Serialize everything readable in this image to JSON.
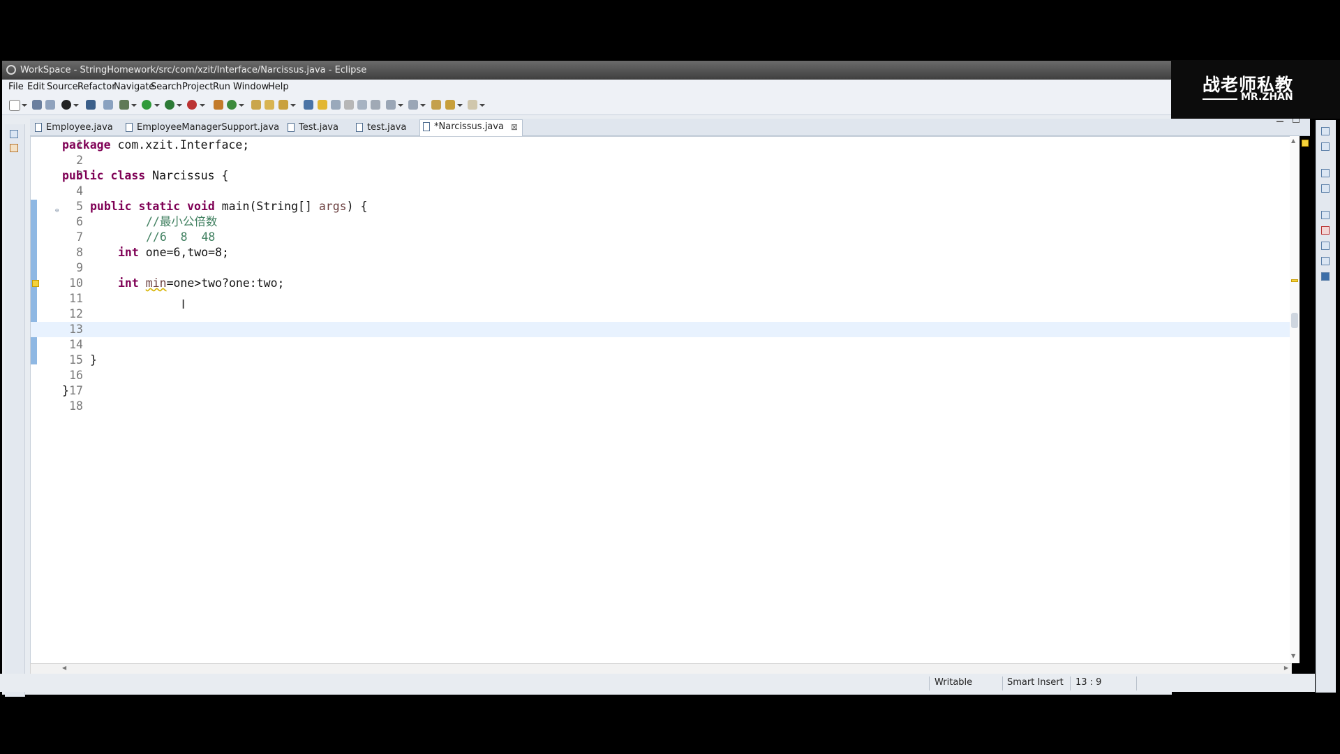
{
  "window": {
    "title": "WorkSpace - StringHomework/src/com/xzit/Interface/Narcissus.java - Eclipse"
  },
  "menu": [
    "File",
    "Edit",
    "Source",
    "Refactor",
    "Navigate",
    "Search",
    "Project",
    "Run",
    "Window",
    "Help"
  ],
  "tabs": [
    {
      "label": "Employee.java"
    },
    {
      "label": "EmployeeManagerSupport.java"
    },
    {
      "label": "Test.java"
    },
    {
      "label": "test.java"
    },
    {
      "label": "*Narcissus.java"
    }
  ],
  "active_tab_close": "⊠",
  "lines": [
    {
      "n": "1"
    },
    {
      "n": "2"
    },
    {
      "n": "3"
    },
    {
      "n": "4"
    },
    {
      "n": "5"
    },
    {
      "n": "6"
    },
    {
      "n": "7"
    },
    {
      "n": "8"
    },
    {
      "n": "9"
    },
    {
      "n": "10"
    },
    {
      "n": "11"
    },
    {
      "n": "12"
    },
    {
      "n": "13"
    },
    {
      "n": "14"
    },
    {
      "n": "15"
    },
    {
      "n": "16"
    },
    {
      "n": "17"
    },
    {
      "n": "18"
    }
  ],
  "code": {
    "l1_kw": "package",
    "l1_rest": " com.xzit.Interface;",
    "l3_kw": "public class",
    "l3_rest": " Narcissus {",
    "l5_kw": "public static void",
    "l5_a": " main(String[] ",
    "l5_var": "args",
    "l5_b": ") {",
    "l6": "//最小公倍数",
    "l7": "//6  8  48",
    "l8_kw": "int",
    "l8_rest": " one=6,two=8;",
    "l10_kw": "int",
    "l10_var": "min",
    "l10_rest": "=one>two?one:two;",
    "l15": "}",
    "l17": "}"
  },
  "status": {
    "writable": "Writable",
    "insert_mode": "Smart Insert",
    "position": "13 : 9"
  },
  "logo": {
    "chinese": "战老师私教",
    "english": "MR.ZHAN"
  },
  "icons": {
    "title": "eclipse-icon",
    "fold": "collapse-icon",
    "warning": "warning-icon"
  }
}
